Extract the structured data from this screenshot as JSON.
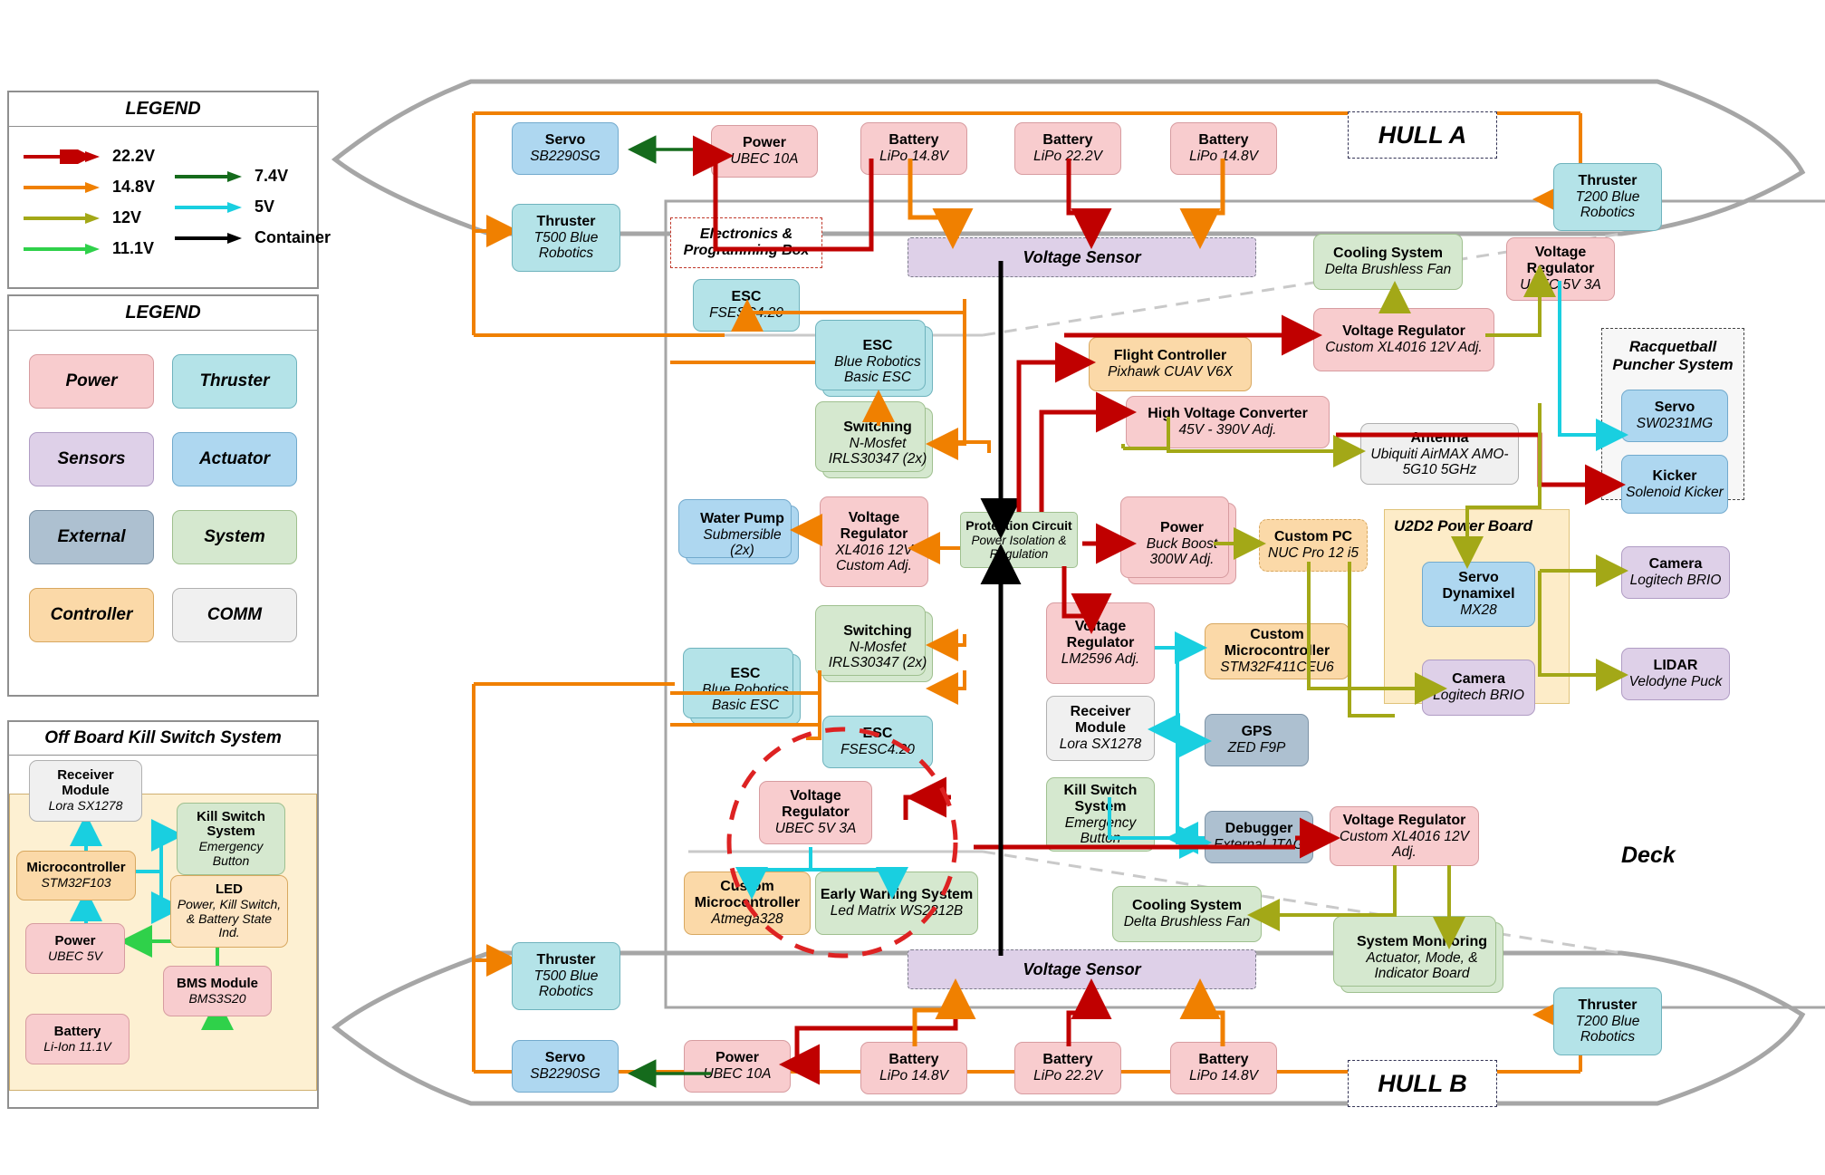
{
  "legend_lines": {
    "title": "LEGEND",
    "left": [
      {
        "label": "22.2V",
        "color": "#c00000"
      },
      {
        "label": "14.8V",
        "color": "#f08000"
      },
      {
        "label": "12V",
        "color": "#a3a817"
      },
      {
        "label": "11.1V",
        "color": "#2fd14a"
      }
    ],
    "right": [
      {
        "label": "7.4V",
        "color": "#156b1c"
      },
      {
        "label": "5V",
        "color": "#19cfe0"
      },
      {
        "label": "Container",
        "color": "#000000"
      }
    ]
  },
  "legend_blocks": {
    "title": "LEGEND",
    "items": [
      {
        "label": "Power",
        "cls": "c-power"
      },
      {
        "label": "Thruster",
        "cls": "c-thruster"
      },
      {
        "label": "Sensors",
        "cls": "c-sensors"
      },
      {
        "label": "Actuator",
        "cls": "c-actuator"
      },
      {
        "label": "External",
        "cls": "c-external"
      },
      {
        "label": "System",
        "cls": "c-system"
      },
      {
        "label": "Controller",
        "cls": "c-control"
      },
      {
        "label": "COMM",
        "cls": "c-comm"
      }
    ]
  },
  "kill_switch_panel": {
    "title": "Off Board Kill Switch System",
    "nodes": {
      "receiver": {
        "t": "Receiver Module",
        "s": "Lora SX1278"
      },
      "microcontroller": {
        "t": "Microcontroller",
        "s": "STM32F103"
      },
      "kill_switch": {
        "t": "Kill Switch System",
        "s": "Emergency Button"
      },
      "led": {
        "t": "LED",
        "s": "Power, Kill Switch, & Battery State Ind."
      },
      "power": {
        "t": "Power",
        "s": "UBEC 5V"
      },
      "bms": {
        "t": "BMS Module",
        "s": "BMS3S20"
      },
      "battery": {
        "t": "Battery",
        "s": "Li-Ion 11.1V"
      }
    }
  },
  "labels": {
    "hull_a": "HULL A",
    "hull_b": "HULL B",
    "deck": "Deck",
    "electronics_box": "Electronics & Programming Box",
    "racquetball": "Racquetball Puncher System",
    "u2d2": "U2D2 Power Board",
    "voltage_sensor_top": "Voltage Sensor",
    "voltage_sensor_bottom": "Voltage Sensor"
  },
  "hull_a": {
    "servo": {
      "t": "Servo",
      "s": "SB2290SG"
    },
    "power_ubec": {
      "t": "Power",
      "s": "UBEC 10A"
    },
    "battery1": {
      "t": "Battery",
      "s": "LiPo 14.8V"
    },
    "battery2": {
      "t": "Battery",
      "s": "LiPo 22.2V"
    },
    "battery3": {
      "t": "Battery",
      "s": "LiPo 14.8V"
    },
    "thruster_t500": {
      "t": "Thruster",
      "s": "T500 Blue Robotics"
    },
    "thruster_t200": {
      "t": "Thruster",
      "s": "T200 Blue Robotics"
    },
    "esc_fsesc": {
      "t": "ESC",
      "s": "FSESC4.20"
    },
    "esc_blue": {
      "t": "ESC",
      "s": "Blue Robotics Basic ESC"
    },
    "switching": {
      "t": "Switching",
      "s": "N-Mosfet IRLS30347 (2x)"
    },
    "cooling": {
      "t": "Cooling System",
      "s": "Delta Brushless Fan"
    },
    "vreg_xl4016_12v": {
      "t": "Voltage Regulator",
      "s": "Custom XL4016 12V Adj."
    },
    "vreg_ubec5v3a": {
      "t": "Voltage Regulator",
      "s": "UBEC 5V 3A"
    },
    "flight_ctrl": {
      "t": "Flight Controller",
      "s": "Pixhawk CUAV V6X"
    },
    "hv_converter": {
      "t": "High Voltage Converter",
      "s": "45V - 390V Adj."
    },
    "antenna": {
      "t": "Antenna",
      "s": "Ubiquiti AirMAX AMO-5G10 5GHz"
    },
    "servo_sw0231": {
      "t": "Servo",
      "s": "SW0231MG"
    },
    "kicker": {
      "t": "Kicker",
      "s": "Solenoid Kicker"
    },
    "water_pump": {
      "t": "Water Pump",
      "s": "Submersible (2x)"
    },
    "vreg_xl4016_custom": {
      "t": "Voltage Regulator",
      "s": "XL4016 12V Custom Adj."
    },
    "protection": {
      "t": "Protection Circuit",
      "s": "Power Isolation & Regulation"
    },
    "buck_boost": {
      "t": "Power",
      "s": "Buck Boost 300W Adj."
    },
    "custom_pc": {
      "t": "Custom PC",
      "s": "NUC Pro 12 i5"
    },
    "servo_dynamixel": {
      "t": "Servo Dynamixel",
      "s": "MX28"
    },
    "camera_brio_r": {
      "t": "Camera",
      "s": "Logitech BRIO"
    },
    "camera_brio_l": {
      "t": "Camera",
      "s": "Logitech BRIO"
    },
    "lidar": {
      "t": "LIDAR",
      "s": "Velodyne Puck"
    },
    "esc_blue2": {
      "t": "ESC",
      "s": "Blue Robotics Basic ESC"
    },
    "switching2": {
      "t": "Switching",
      "s": "N-Mosfet IRLS30347 (2x)"
    },
    "esc_fsesc2": {
      "t": "ESC",
      "s": "FSESC4.20"
    },
    "vreg_lm2596": {
      "t": "Voltage Regulator",
      "s": "LM2596 Adj."
    },
    "custom_mcu": {
      "t": "Custom Microcontroller",
      "s": "STM32F411CEU6"
    },
    "receiver": {
      "t": "Receiver Module",
      "s": "Lora SX1278"
    },
    "gps": {
      "t": "GPS",
      "s": "ZED F9P"
    },
    "kill_switch": {
      "t": "Kill Switch System",
      "s": "Emergency Button"
    },
    "debugger": {
      "t": "Debugger",
      "s": "External JTAG"
    },
    "vreg_xl4016_12v_b": {
      "t": "Voltage Regulator",
      "s": "Custom XL4016 12V Adj."
    },
    "vreg_ubec5v3a_b": {
      "t": "Voltage Regulator",
      "s": "UBEC 5V 3A"
    },
    "custom_mcu_atmega": {
      "t": "Custom Microcontroller",
      "s": "Atmega328"
    },
    "early_warning": {
      "t": "Early Warning System",
      "s": "Led Matrix WS2812B"
    },
    "cooling_b": {
      "t": "Cooling System",
      "s": "Delta Brushless Fan"
    },
    "sys_monitoring": {
      "t": "System Monitoring",
      "s": "Actuator, Mode, & Indicator Board"
    }
  },
  "hull_b": {
    "thruster_t500": {
      "t": "Thruster",
      "s": "T500  Blue Robotics"
    },
    "thruster_t200": {
      "t": "Thruster",
      "s": "T200  Blue Robotics"
    },
    "servo": {
      "t": "Servo",
      "s": "SB2290SG"
    },
    "power_ubec": {
      "t": "Power",
      "s": "UBEC 10A"
    },
    "battery1": {
      "t": "Battery",
      "s": "LiPo 14.8V"
    },
    "battery2": {
      "t": "Battery",
      "s": "LiPo 22.2V"
    },
    "battery3": {
      "t": "Battery",
      "s": "LiPo 14.8V"
    }
  },
  "colors": {
    "v22_2": "#c00000",
    "v14_8": "#f08000",
    "v12": "#a3a817",
    "v11_1": "#2fd14a",
    "v7_4": "#156b1c",
    "v5": "#19cfe0",
    "container": "#000000",
    "hull_outline": "#a6a6a6"
  }
}
